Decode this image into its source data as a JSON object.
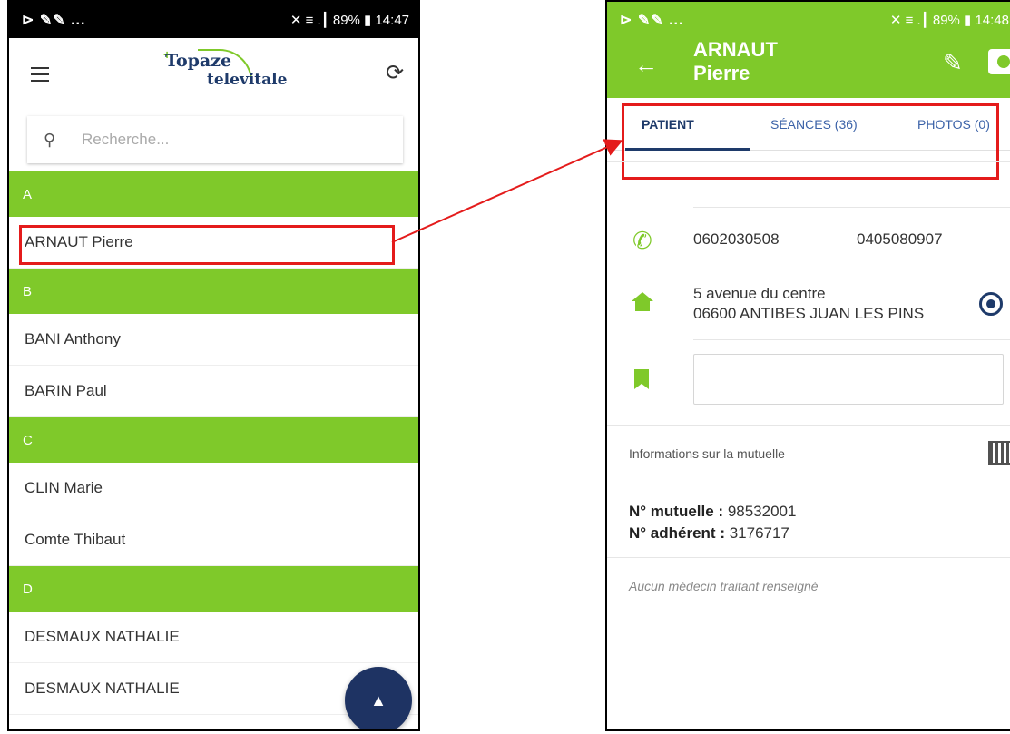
{
  "left": {
    "status": {
      "icons": "⊵ 🔧🔧 ...",
      "right": "✕ ≡ .┃ 89% ▮ 14:47"
    },
    "logo": {
      "part1": "Topaze",
      "part2": "televitale"
    },
    "search": {
      "placeholder": "Recherche..."
    },
    "sections": [
      {
        "letter": "A",
        "items": [
          "ARNAUT Pierre"
        ]
      },
      {
        "letter": "B",
        "items": [
          "BANI Anthony",
          "BARIN Paul"
        ]
      },
      {
        "letter": "C",
        "items": [
          "CLIN Marie",
          "Comte Thibaut"
        ]
      },
      {
        "letter": "D",
        "items": [
          "DESMAUX NATHALIE",
          "DESMAUX NATHALIE"
        ]
      }
    ]
  },
  "right": {
    "status": {
      "icons": "⊵ 🔧🔧 ...",
      "right": "✕ ≡ .┃ 89% ▮ 14:48"
    },
    "patient": {
      "last_name": "ARNAUT",
      "first_name": "Pierre"
    },
    "tabs": {
      "patient": "PATIENT",
      "seances": "SÉANCES (36)",
      "photos": "PHOTOS (0)"
    },
    "contact": {
      "phone1": "0602030508",
      "phone2": "0405080907"
    },
    "address": {
      "line1": "5 avenue du centre",
      "line2": "06600 ANTIBES JUAN LES PINS"
    },
    "mutuelle": {
      "title": "Informations sur la mutuelle",
      "num_label": "N° mutuelle :",
      "num_value": " 98532001",
      "adh_label": "N° adhérent :",
      "adh_value": " 3176717"
    },
    "doctor_note": "Aucun médecin traitant renseigné"
  },
  "colors": {
    "accent": "#7fc92a",
    "navy": "#1e3363",
    "highlight": "#e41b1b"
  }
}
